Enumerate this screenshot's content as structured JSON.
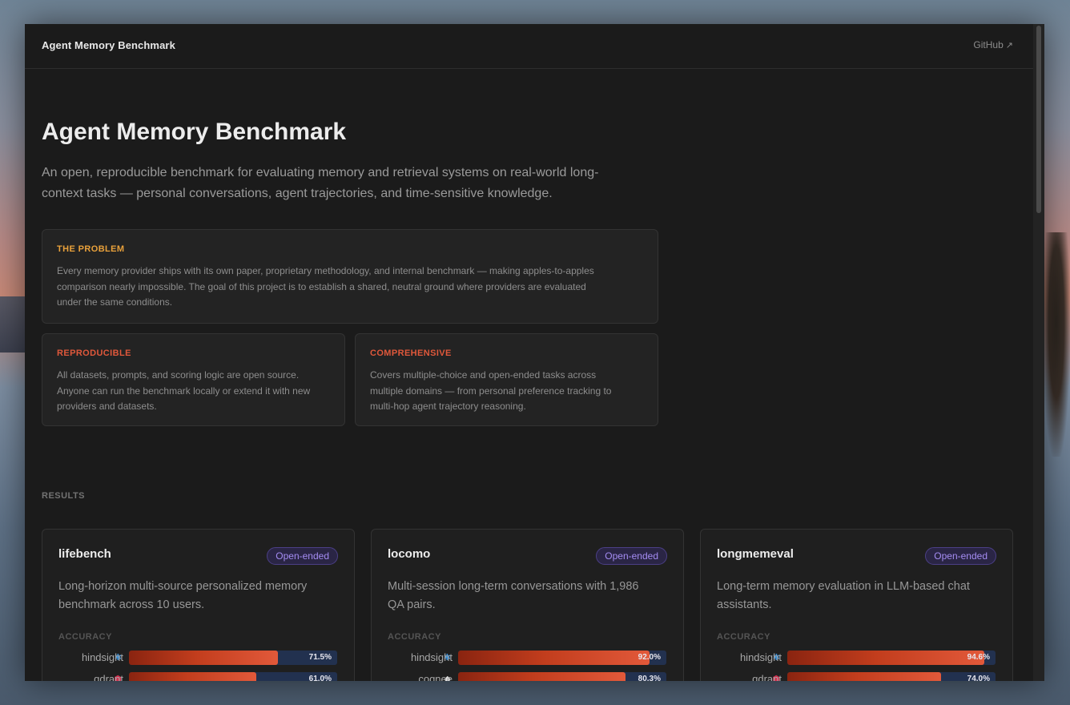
{
  "app": {
    "brand": "Agent Memory Benchmark",
    "github_label": "GitHub",
    "github_arrow": "↗"
  },
  "hero": {
    "title": "Agent Memory Benchmark",
    "subtitle_line1": "An open, reproducible benchmark for evaluating memory and retrieval systems on real-world long-",
    "subtitle_line2": "context tasks — personal conversations, agent trajectories, and time-sensitive knowledge."
  },
  "cards": {
    "problem": {
      "title": "THE PROBLEM",
      "lines": [
        "Every memory provider ships with its own paper, proprietary methodology, and internal benchmark — making apples-to-apples",
        "comparison nearly impossible. The goal of this project is to establish a shared, neutral ground where providers are evaluated",
        "under the same conditions."
      ],
      "color": "#e9a13b"
    },
    "reproducible": {
      "title": "REPRODUCIBLE",
      "lines": [
        "All datasets, prompts, and scoring logic are open source.",
        "Anyone can run the benchmark locally or extend it with new",
        "providers and datasets."
      ],
      "color": "#e0583b"
    },
    "comprehensive": {
      "title": "COMPREHENSIVE",
      "lines": [
        "Covers multiple-choice and open-ended tasks across",
        "multiple domains — from personal preference tracking to",
        "multi-hop agent trajectory reasoning."
      ],
      "color": "#e0583b"
    }
  },
  "results": {
    "section_label": "RESULTS",
    "accuracy_label": "ACCURACY",
    "benchmarks": [
      {
        "name": "lifebench",
        "badge": "Open-ended",
        "desc_line1": "Long-horizon multi-source personalized memory",
        "desc_line2": "benchmark across 10 users.",
        "rows": [
          {
            "provider": "hindsight",
            "icon": "hindsight-icon",
            "value": 71.5,
            "label": "71.5%"
          },
          {
            "provider": "qdrant",
            "icon": "qdrant-icon",
            "value": 61.0,
            "label": "61.0%"
          }
        ]
      },
      {
        "name": "locomo",
        "badge": "Open-ended",
        "desc_line1": "Multi-session long-term conversations with 1,986",
        "desc_line2": "QA pairs.",
        "rows": [
          {
            "provider": "hindsight",
            "icon": "hindsight-icon",
            "value": 92.0,
            "label": "92.0%"
          },
          {
            "provider": "cognee",
            "icon": "cognee-icon",
            "value": 80.3,
            "label": "80.3%"
          }
        ]
      },
      {
        "name": "longmemeval",
        "badge": "Open-ended",
        "desc_line1": "Long-term memory evaluation in LLM-based chat",
        "desc_line2": "assistants.",
        "rows": [
          {
            "provider": "hindsight",
            "icon": "hindsight-icon",
            "value": 94.6,
            "label": "94.6%"
          },
          {
            "provider": "qdrant",
            "icon": "qdrant-icon",
            "value": 74.0,
            "label": "74.0%"
          }
        ]
      }
    ]
  },
  "colors": {
    "accent_bar": "#c23d1d",
    "bar_track": "#22314f",
    "badge_text": "#a48cf2"
  }
}
